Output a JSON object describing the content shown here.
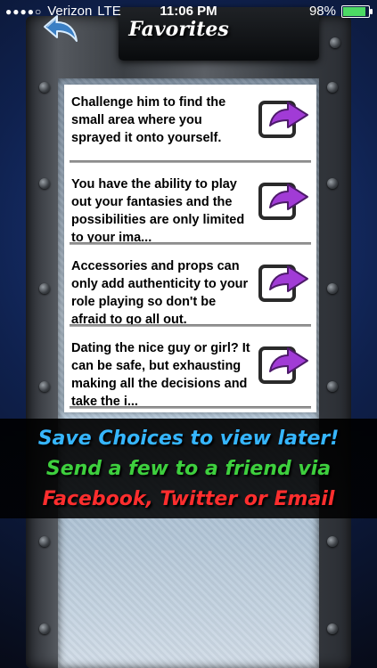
{
  "status_bar": {
    "signal_dots": "●●●●○",
    "carrier": "Verizon",
    "network": "LTE",
    "time": "11:06 PM",
    "battery_percent": "98%",
    "battery_level": 0.98
  },
  "header": {
    "title": "Favorites",
    "back_icon": "back-arrow-icon"
  },
  "favorites": [
    {
      "text": "Challenge him to find the small area where you sprayed it onto yourself.",
      "share_icon": "share-arrow-icon"
    },
    {
      "text": "You have the ability to play out your fantasies and the possibilities are only limited to your ima...",
      "share_icon": "share-arrow-icon"
    },
    {
      "text": "Accessories and props can only add authenticity to your role playing so don't be afraid to go all out.",
      "share_icon": "share-arrow-icon"
    },
    {
      "text": "Dating the nice guy or girl?  It can be safe, but exhausting making all the decisions and take the i...",
      "share_icon": "share-arrow-icon"
    }
  ],
  "promo": {
    "line1": "Save Choices to view later!",
    "line2": "Send a few to a friend via",
    "line3": "Facebook, Twitter or Email"
  },
  "colors": {
    "promo_blue": "#36b6ff",
    "promo_green": "#3ed03e",
    "promo_red": "#ff2e2e",
    "share_purple": "#a13bd6"
  }
}
